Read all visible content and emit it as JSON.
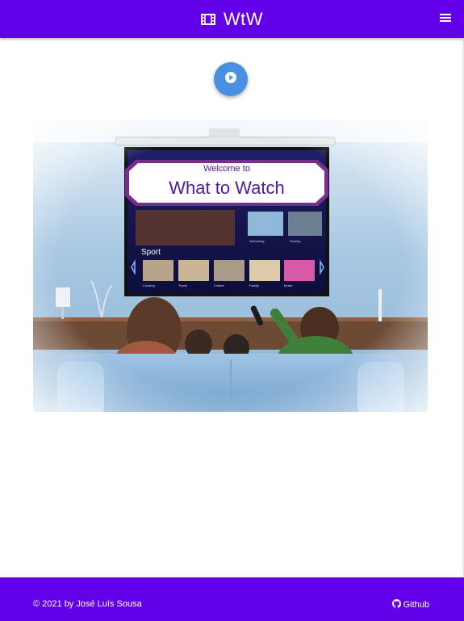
{
  "header": {
    "title": "WtW",
    "brand_icon": "film-icon",
    "menu_icon": "hamburger-menu-icon"
  },
  "main": {
    "play_button_icon": "play-icon",
    "hero": {
      "screen_greeting": "Welcome to",
      "screen_title": "What to Watch",
      "section_title": "Sport",
      "top_thumbnails": [
        "Swimming",
        "Rowing"
      ],
      "categories": [
        "Cooking",
        "Travel",
        "Culture",
        "Family",
        "Music"
      ]
    }
  },
  "footer": {
    "copyright": "© 2021 by José Luís Sousa",
    "github_icon": "github-icon",
    "github_label": "Github"
  },
  "colors": {
    "primary": "#6200ea",
    "fab": "#4a90e2"
  }
}
